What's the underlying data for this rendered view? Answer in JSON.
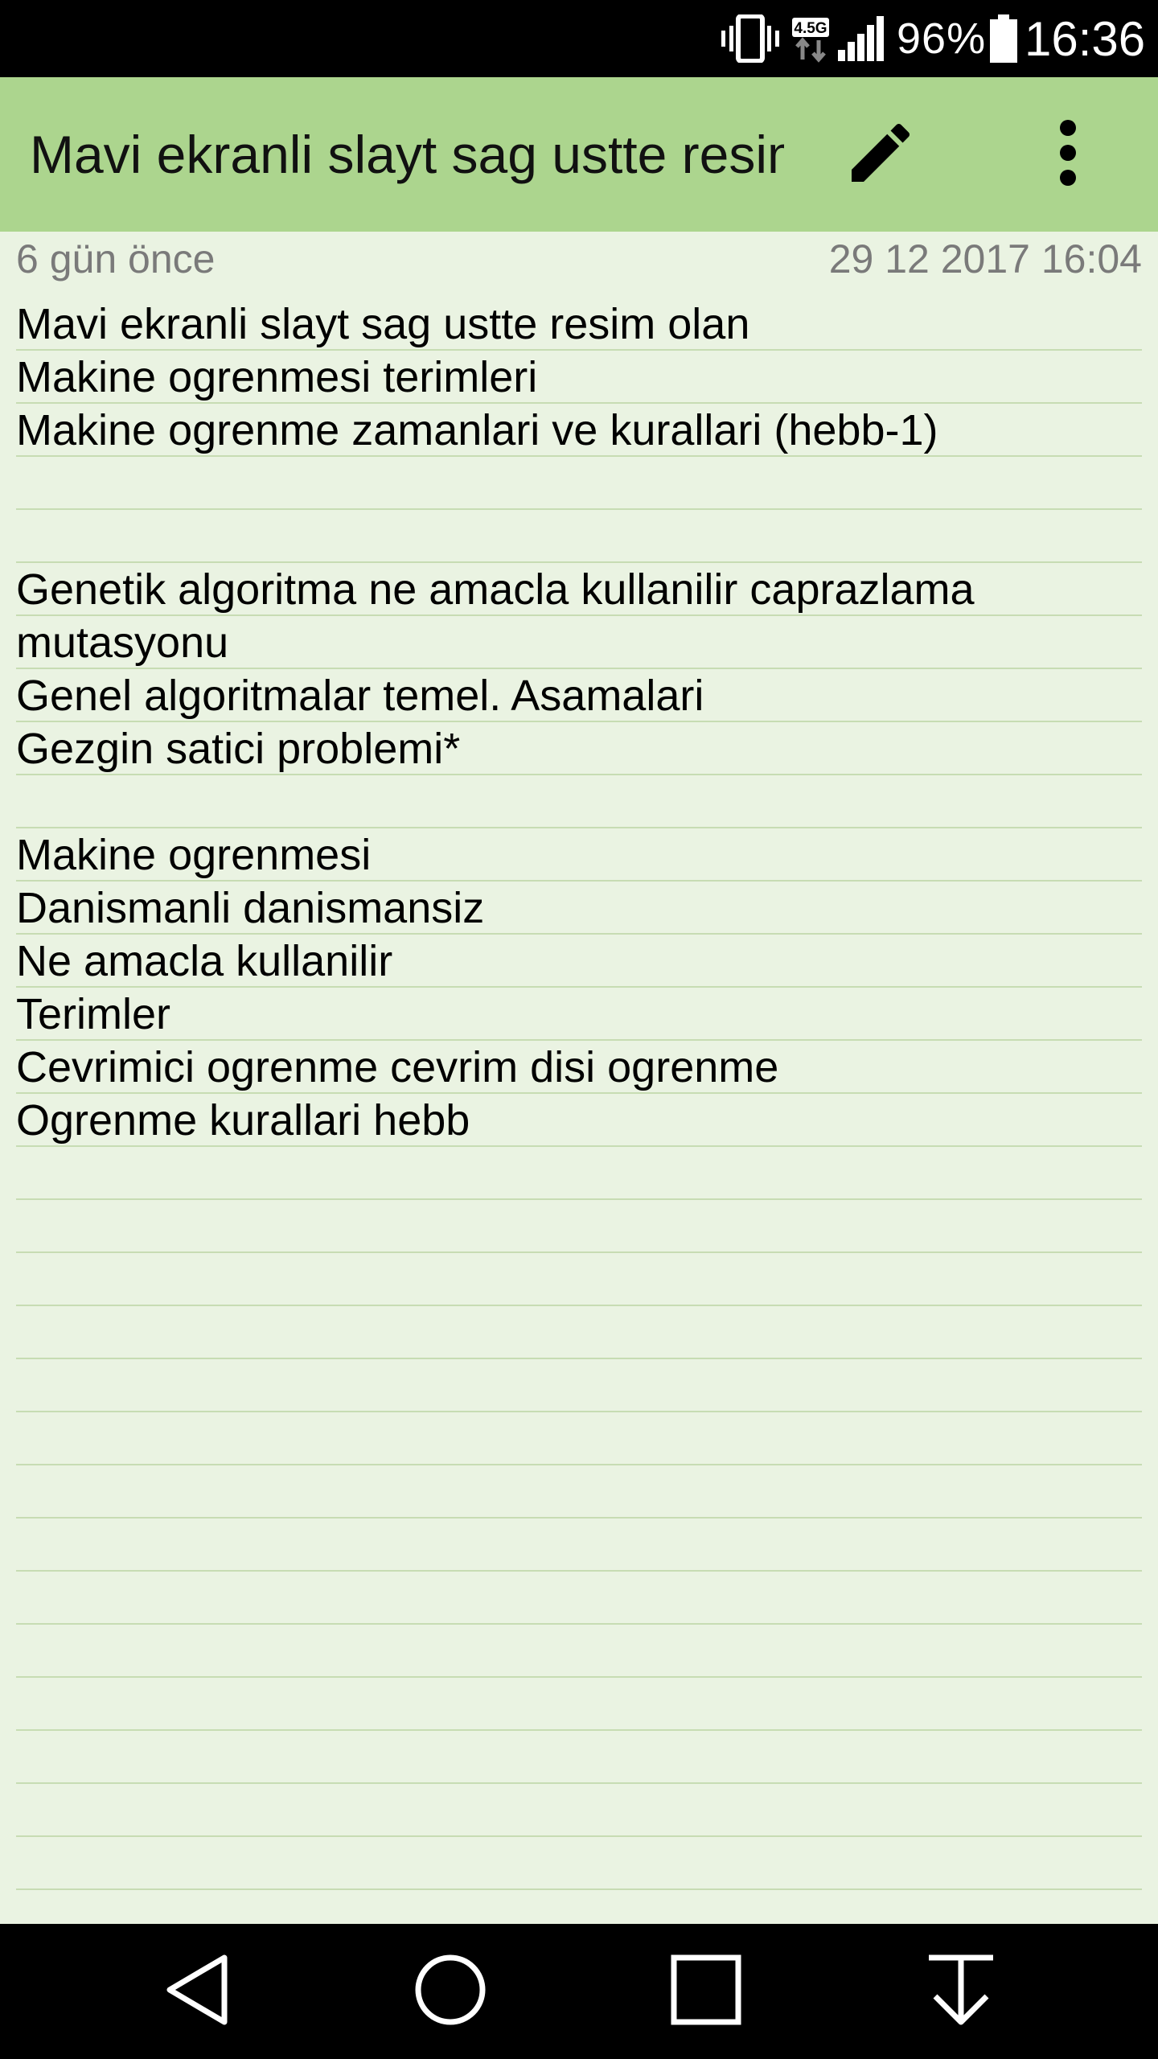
{
  "status_bar": {
    "network_label": "4.5G",
    "battery_percent": "96%",
    "battery_level": 0.96,
    "time": "16:36",
    "icons": [
      "vibrate-icon",
      "network-4-5g-icon",
      "cell-signal-icon",
      "battery-icon"
    ]
  },
  "app_bar": {
    "title": "Mavi ekranli slayt sag ustte resim olan",
    "edit_icon": "pencil-icon",
    "menu_icon": "more-vertical-icon",
    "background_color": "#acd58e"
  },
  "note": {
    "age": "6 gün önce",
    "date": "29 12 2017 16:04",
    "lines": [
      "Mavi ekranli slayt sag ustte resim olan",
      "Makine ogrenmesi terimleri",
      "Makine ogrenme zamanlari ve kurallari (hebb-1)",
      "",
      "",
      "Genetik algoritma ne amacla kullanilir caprazlama",
      "mutasyonu",
      "Genel algoritmalar temel. Asamalari",
      "Gezgin satici problemi*",
      "",
      "Makine ogrenmesi",
      "Danismanli danismansiz",
      "Ne amacla kullanilir",
      "Terimler",
      "Cevrimici ogrenme cevrim disi ogrenme",
      "Ogrenme kurallari hebb"
    ],
    "background_color": "#eaf3e2",
    "rule_color": "#c7dcb3"
  },
  "nav_bar": {
    "icons": [
      "back-icon",
      "home-icon",
      "recents-icon",
      "notification-pull-down-icon"
    ]
  }
}
